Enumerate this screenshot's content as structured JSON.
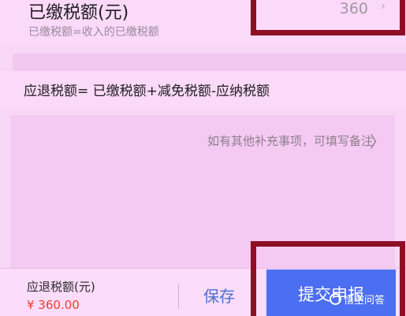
{
  "paid_tax": {
    "label": "已缴税额(元)",
    "hint": "已缴税额=收入的已缴税额",
    "value": "360",
    "chevron": "›"
  },
  "formula": {
    "text": "应退税额= 已缴税额+减免税额-应纳税额"
  },
  "remark": {
    "placeholder": "如有其他补充事项，可填写备注",
    "chevron": "〉"
  },
  "footer": {
    "due_label": "应退税额(元)",
    "due_amount": "¥ 360.00",
    "save_label": "保存",
    "submit_label": "提交申报"
  },
  "watermark": {
    "text": "悟空问答"
  },
  "colors": {
    "annotation_box": "#8e0f24",
    "submit_button": "#4c6ef1",
    "amount": "#e3442f"
  }
}
